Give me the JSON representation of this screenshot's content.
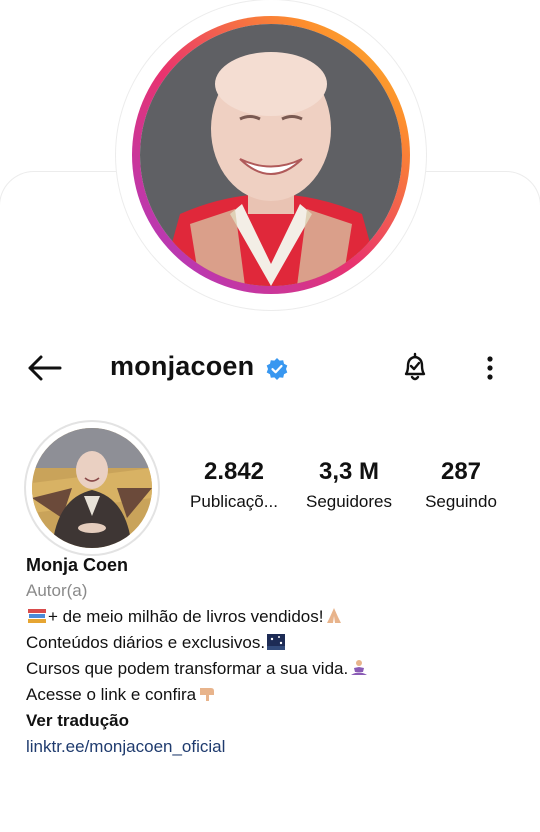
{
  "profile": {
    "username": "monjacoen",
    "verified": true,
    "name": "Monja Coen",
    "category": "Autor(a)"
  },
  "stats": [
    {
      "value": "2.842",
      "label": "Publicaçõ..."
    },
    {
      "value": "3,3 M",
      "label": "Seguidores"
    },
    {
      "value": "287",
      "label": "Seguindo"
    }
  ],
  "bio": {
    "line1": "+ de meio milhão de livros vendidos!",
    "line2": "Conteúdos diários e exclusivos.",
    "line3": "Cursos que podem transformar a sua vida.",
    "line4": "Acesse o link e confira",
    "translate": "Ver tradução",
    "link": "linktr.ee/monjacoen_oficial"
  },
  "icons": {
    "back": "arrow-left-icon",
    "verified": "verified-badge-icon",
    "notifications": "bell-check-icon",
    "more": "more-vertical-icon"
  },
  "colors": {
    "verified": "#3897f0",
    "link": "#1f3b6e",
    "category": "#8a8a8a",
    "ring_start": "#a43bd1",
    "ring_end": "#f9c12f"
  }
}
